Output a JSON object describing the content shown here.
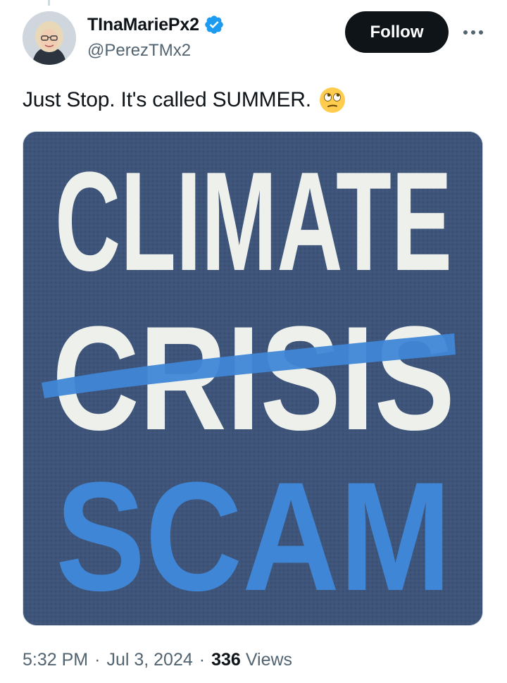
{
  "author": {
    "display_name": "TInaMariePx2",
    "handle": "@PerezTMx2",
    "verified": true,
    "verified_icon": "verified-badge-icon",
    "verified_color": "#1d9bf0"
  },
  "actions": {
    "follow_label": "Follow",
    "more_icon": "more-horizontal-icon"
  },
  "tweet": {
    "text": "Just Stop. It's called SUMMER.",
    "emoji": "face-with-rolling-eyes"
  },
  "media": {
    "lines": [
      "CLIMATE",
      "CRISIS",
      "SCAM"
    ],
    "strikethrough_line": "CRISIS",
    "shirt_color": "#3e5579",
    "stencil_color": "#eef0ec",
    "paint_color": "#3f86d6"
  },
  "meta": {
    "time": "5:32 PM",
    "date": "Jul 3, 2024",
    "separator": "·",
    "views_count": "336",
    "views_label": "Views"
  }
}
